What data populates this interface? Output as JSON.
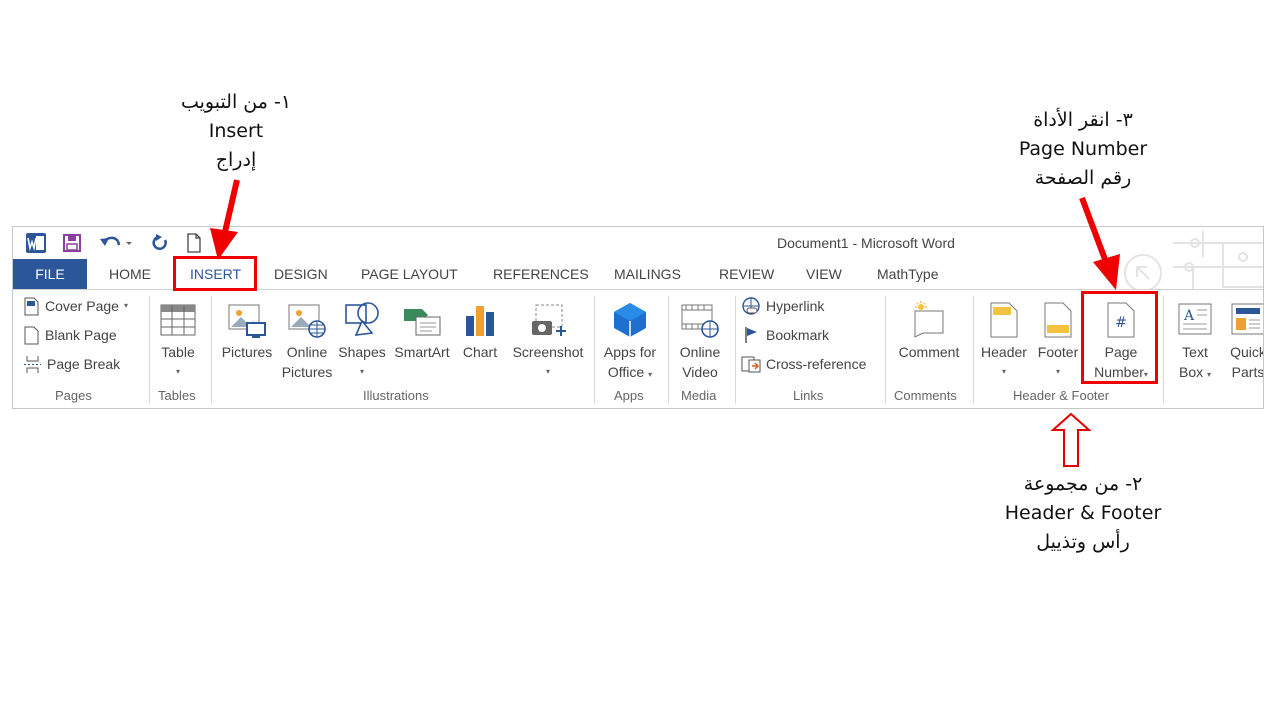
{
  "annotations": {
    "step1": [
      "١- من التبويب",
      "Insert",
      "إدراج"
    ],
    "step2": [
      "٢- من مجموعة",
      "Header & Footer",
      "رأس وتذييل"
    ],
    "step3": [
      "٣- انقر الأداة",
      "Page Number",
      "رقم الصفحة"
    ]
  },
  "window": {
    "title": "Document1 - Microsoft Word"
  },
  "quick_access": [
    "word-icon",
    "save-icon",
    "undo-icon",
    "redo-icon",
    "new-document-icon"
  ],
  "tabs": [
    "FILE",
    "HOME",
    "INSERT",
    "DESIGN",
    "PAGE LAYOUT",
    "REFERENCES",
    "MAILINGS",
    "REVIEW",
    "VIEW",
    "MathType"
  ],
  "active_tab": "INSERT",
  "groups": {
    "pages": {
      "label": "Pages",
      "items": [
        "Cover Page",
        "Blank Page",
        "Page Break"
      ]
    },
    "tables": {
      "label": "Tables",
      "table": "Table"
    },
    "illustrations": {
      "label": "Illustrations",
      "pictures": "Pictures",
      "online_pictures_1": "Online",
      "online_pictures_2": "Pictures",
      "shapes": "Shapes",
      "smartart": "SmartArt",
      "chart": "Chart",
      "screenshot": "Screenshot"
    },
    "apps": {
      "label": "Apps",
      "apps_1": "Apps for",
      "apps_2": "Office"
    },
    "media": {
      "label": "Media",
      "video_1": "Online",
      "video_2": "Video"
    },
    "links": {
      "label": "Links",
      "items": [
        "Hyperlink",
        "Bookmark",
        "Cross-reference"
      ]
    },
    "comments": {
      "label": "Comments",
      "comment": "Comment"
    },
    "header_footer": {
      "label": "Header & Footer",
      "header": "Header",
      "footer": "Footer",
      "page_number_1": "Page",
      "page_number_2": "Number"
    },
    "text": {
      "text_box_1": "Text",
      "text_box_2": "Box",
      "quick_parts_1": "Quick",
      "quick_parts_2": "Parts"
    }
  },
  "colors": {
    "accent": "#2b579a",
    "highlight": "#ee0000"
  }
}
